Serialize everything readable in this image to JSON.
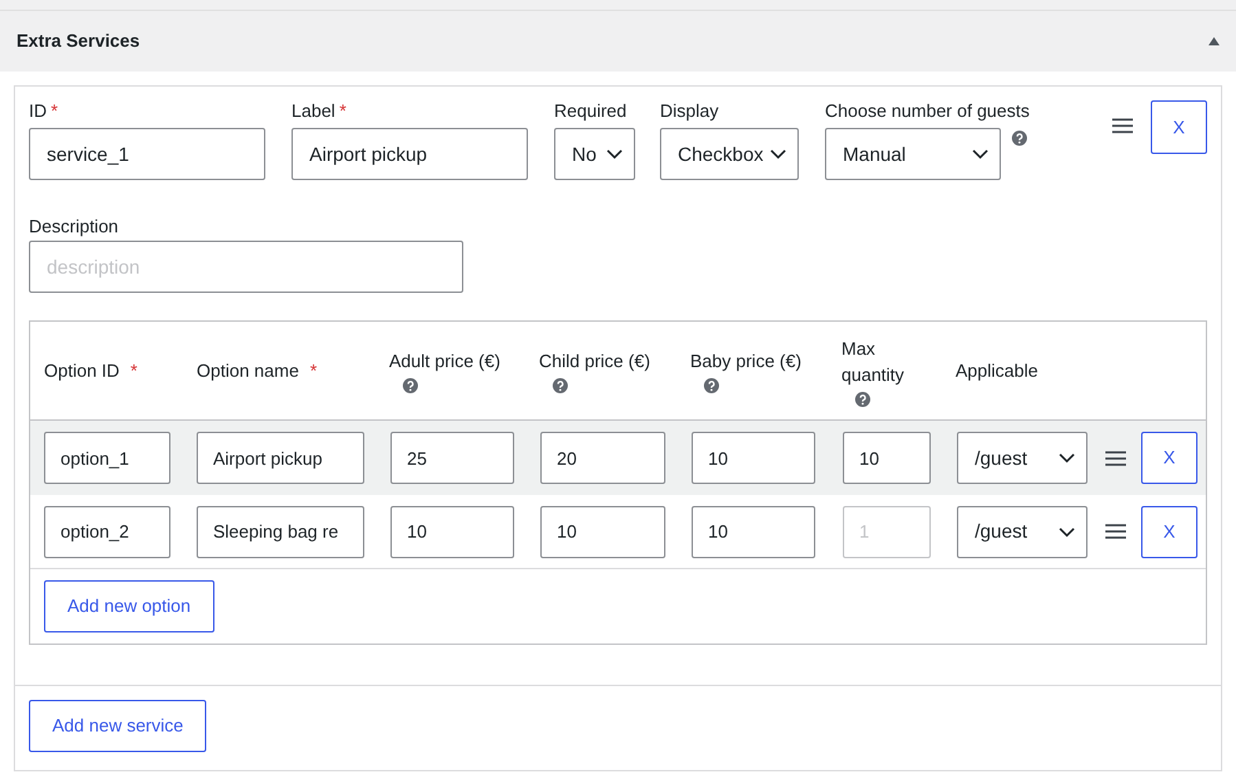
{
  "panel": {
    "title": "Extra Services",
    "expanded": true
  },
  "service": {
    "fields": [
      {
        "kind": "input",
        "label": "ID",
        "required_mark": "*",
        "value": "service_1"
      },
      {
        "kind": "input",
        "label": "Label",
        "required_mark": "*",
        "value": "Airport pickup"
      },
      {
        "kind": "select",
        "label": "Required",
        "value": "No"
      },
      {
        "kind": "select",
        "label": "Display",
        "value": "Checkbox"
      },
      {
        "kind": "select",
        "label": "Choose number of guests",
        "value": "Manual",
        "help": true
      }
    ],
    "remove_button": "X",
    "description": {
      "label": "Description",
      "placeholder": "description"
    },
    "options": {
      "columns": [
        {
          "label": "Option ID",
          "required_mark": "*"
        },
        {
          "label": "Option name",
          "required_mark": "*"
        },
        {
          "label": "Adult price (€)",
          "help": true
        },
        {
          "label": "Child price (€)",
          "help": true
        },
        {
          "label": "Baby price (€)",
          "help": true
        },
        {
          "label": "Max quantity",
          "help": true
        },
        {
          "label": "Applicable"
        }
      ],
      "rows": [
        {
          "highlighted": true,
          "option_id": "option_1",
          "option_name": "Airport pickup",
          "adult": "25",
          "child": "20",
          "baby": "10",
          "max_quantity": {
            "value": "10"
          },
          "applicable": "/guest",
          "remove": "X"
        },
        {
          "highlighted": false,
          "option_id": "option_2",
          "option_name": "Sleeping bag re",
          "adult": "10",
          "child": "10",
          "baby": "10",
          "max_quantity": {
            "placeholder": "1"
          },
          "applicable": "/guest",
          "remove": "X"
        }
      ],
      "add_button": "Add new option"
    }
  },
  "add_service_button": "Add new service"
}
